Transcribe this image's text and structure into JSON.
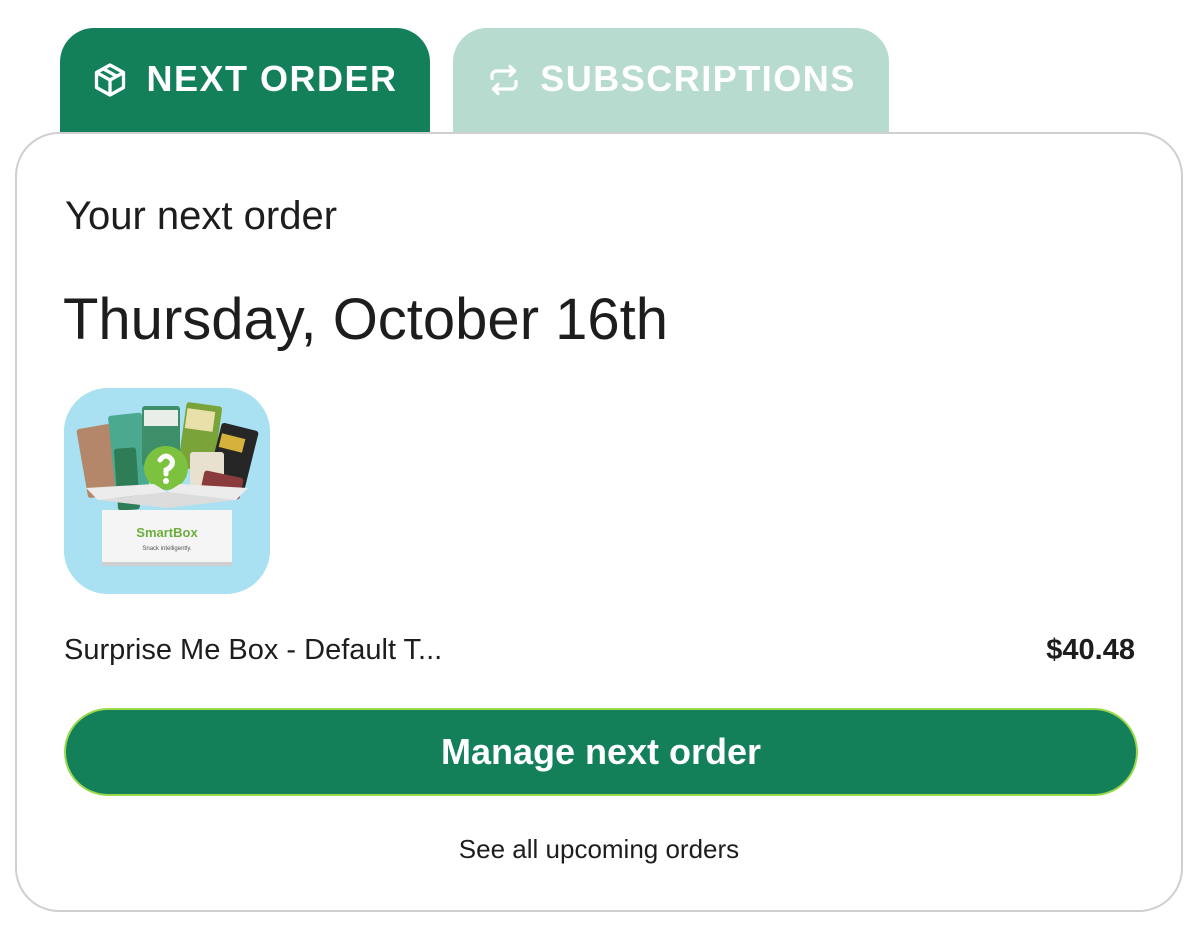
{
  "tabs": [
    {
      "label": "NEXT ORDER",
      "icon": "box-icon",
      "active": true
    },
    {
      "label": "SUBSCRIPTIONS",
      "icon": "repeat-icon",
      "active": false
    }
  ],
  "order": {
    "heading": "Your next order",
    "date": "Thursday, October 16th",
    "product_name": "Surprise Me Box - Default T...",
    "product_price": "$40.48",
    "image_text": {
      "brand": "SmartBox",
      "tagline": "Snack intelligently."
    }
  },
  "actions": {
    "manage_label": "Manage next order",
    "see_all_label": "See all upcoming orders"
  },
  "colors": {
    "primary": "#13805a",
    "tab_inactive": "#b7dbce",
    "button_border": "#9bd84a",
    "image_bg": "#a9e1f2"
  }
}
